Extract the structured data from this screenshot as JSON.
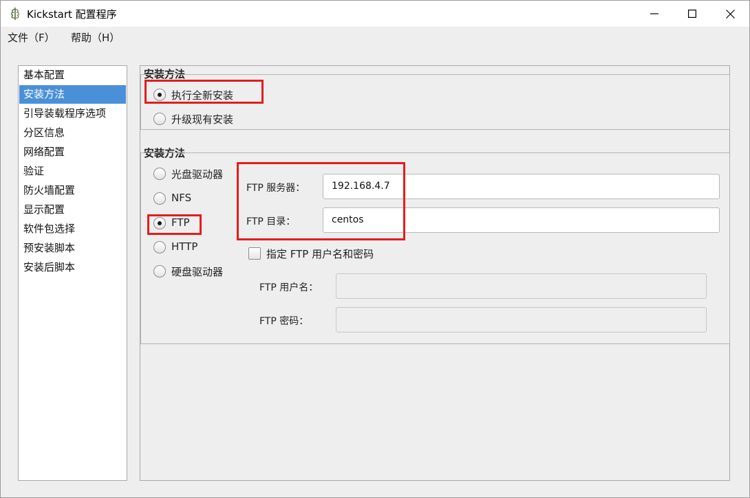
{
  "window": {
    "title": "Kickstart 配置程序",
    "controls": [
      "minimize",
      "maximize",
      "close"
    ]
  },
  "menu": [
    {
      "label": "文件（F）"
    },
    {
      "label": "帮助（H）"
    }
  ],
  "sidebar": {
    "selected_index": 1,
    "items": [
      {
        "label": "基本配置"
      },
      {
        "label": "安装方法"
      },
      {
        "label": "引导装载程序选项"
      },
      {
        "label": "分区信息"
      },
      {
        "label": "网络配置"
      },
      {
        "label": "验证"
      },
      {
        "label": "防火墙配置"
      },
      {
        "label": "显示配置"
      },
      {
        "label": "软件包选择"
      },
      {
        "label": "预安装脚本"
      },
      {
        "label": "安装后脚本"
      }
    ]
  },
  "install_type": {
    "title": "安装方法",
    "options": [
      {
        "label": "执行全新安装",
        "selected": true
      },
      {
        "label": "升级现有安装",
        "selected": false
      }
    ]
  },
  "install_source": {
    "title": "安装方法",
    "options": [
      {
        "label": "光盘驱动器",
        "selected": false
      },
      {
        "label": "NFS",
        "selected": false
      },
      {
        "label": "FTP",
        "selected": true
      },
      {
        "label": "HTTP",
        "selected": false
      },
      {
        "label": "硬盘驱动器",
        "selected": false
      }
    ],
    "ftp_server": {
      "label": "FTP 服务器：",
      "value": "192.168.4.7"
    },
    "ftp_dir": {
      "label": "FTP 目录：",
      "value": "centos"
    },
    "specify_credentials": {
      "label": "指定 FTP 用户名和密码",
      "checked": false
    },
    "ftp_user": {
      "label": "FTP 用户名：",
      "value": ""
    },
    "ftp_password": {
      "label": "FTP 密码：",
      "value": ""
    }
  },
  "colors": {
    "selection": "#4a90d9",
    "highlight_box": "#e51b1b",
    "background": "#eeeeee"
  }
}
